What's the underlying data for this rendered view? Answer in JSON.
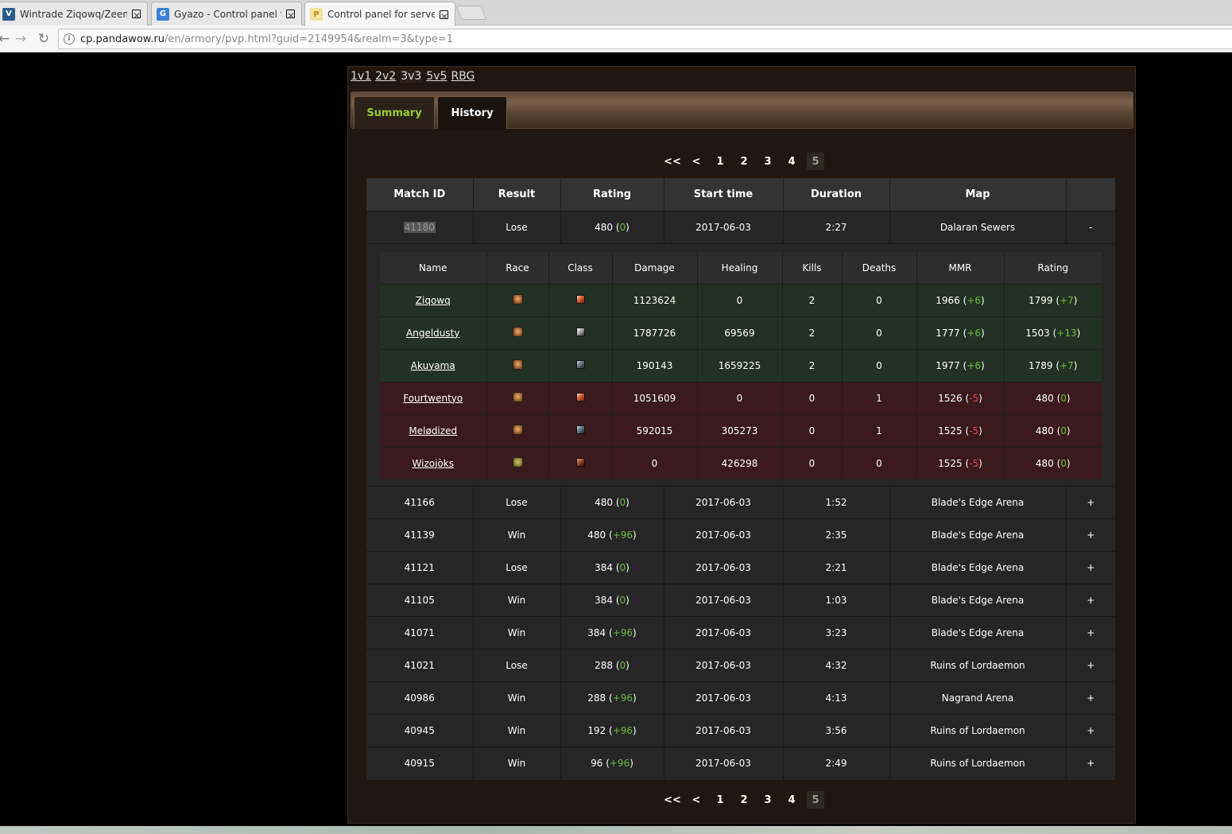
{
  "browser": {
    "tabs": [
      {
        "title": "Wintrade Ziqowq/Zeems",
        "fav": "V",
        "fav_bg": "#2a5d8f"
      },
      {
        "title": "Gyazo - Control panel fo",
        "fav": "G",
        "fav_bg": "#3b7fd6"
      },
      {
        "title": "Control panel for server",
        "fav": "P",
        "fav_bg": "#f3e3a0"
      }
    ],
    "close_glyph": "✕",
    "url_host": "cp.pandawow.ru",
    "url_path": "/en/armory/pvp.html?guid=2149954&realm=3&type=1"
  },
  "brackets": [
    "1v1",
    "2v2",
    "3v3",
    "5v5",
    "RBG"
  ],
  "current_bracket": "3v3",
  "tabs": {
    "summary": "Summary",
    "history": "History"
  },
  "pager": {
    "first": "<<",
    "prev": "<",
    "pages": [
      "1",
      "2",
      "3",
      "4"
    ],
    "current": "5"
  },
  "match_headers": [
    "Match ID",
    "Result",
    "Rating",
    "Start time",
    "Duration",
    "Map",
    ""
  ],
  "expanded_match": {
    "id": "41180",
    "result": "Lose",
    "rating": "480",
    "rating_change": "0",
    "start": "2017-06-03",
    "duration": "2:27",
    "map": "Dalaran Sewers",
    "toggle": "-"
  },
  "detail_headers": [
    "Name",
    "Race",
    "Class",
    "Damage",
    "Healing",
    "Kills",
    "Deaths",
    "MMR",
    "Rating"
  ],
  "players": [
    {
      "name": "Ziqowq",
      "race": "orc-icon",
      "class": "rogue-icon",
      "damage": "1123624",
      "healing": "0",
      "kills": "2",
      "deaths": "0",
      "mmr": "1966",
      "mmr_change": "+6",
      "rating": "1799",
      "rating_change": "+7",
      "team": "winner"
    },
    {
      "name": "Angeldusty",
      "race": "orc-icon",
      "class": "warrior-icon",
      "damage": "1787726",
      "healing": "69569",
      "kills": "2",
      "deaths": "0",
      "mmr": "1777",
      "mmr_change": "+6",
      "rating": "1503",
      "rating_change": "+13",
      "team": "winner"
    },
    {
      "name": "Akuyama",
      "race": "orc-icon",
      "class": "priest-icon",
      "damage": "190143",
      "healing": "1659225",
      "kills": "2",
      "deaths": "0",
      "mmr": "1977",
      "mmr_change": "+6",
      "rating": "1789",
      "rating_change": "+7",
      "team": "winner"
    },
    {
      "name": "Fourtwentyo",
      "race": "orc-icon",
      "class": "rogue-icon",
      "damage": "1051609",
      "healing": "0",
      "kills": "0",
      "deaths": "1",
      "mmr": "1526",
      "mmr_change": "-5",
      "rating": "480",
      "rating_change": "0",
      "team": "loser"
    },
    {
      "name": "Melødized",
      "race": "orc-icon",
      "class": "priest-icon",
      "damage": "592015",
      "healing": "305273",
      "kills": "0",
      "deaths": "1",
      "mmr": "1525",
      "mmr_change": "-5",
      "rating": "480",
      "rating_change": "0",
      "team": "loser"
    },
    {
      "name": "Wizojòks",
      "race": "goblin-icon",
      "class": "warlock-icon",
      "damage": "0",
      "healing": "426298",
      "kills": "0",
      "deaths": "0",
      "mmr": "1525",
      "mmr_change": "-5",
      "rating": "480",
      "rating_change": "0",
      "team": "loser"
    }
  ],
  "matches": [
    {
      "id": "41166",
      "result": "Lose",
      "rating": "480",
      "rating_change": "0",
      "start": "2017-06-03",
      "duration": "1:52",
      "map": "Blade's Edge Arena",
      "toggle": "+"
    },
    {
      "id": "41139",
      "result": "Win",
      "rating": "480",
      "rating_change": "+96",
      "start": "2017-06-03",
      "duration": "2:35",
      "map": "Blade's Edge Arena",
      "toggle": "+"
    },
    {
      "id": "41121",
      "result": "Lose",
      "rating": "384",
      "rating_change": "0",
      "start": "2017-06-03",
      "duration": "2:21",
      "map": "Blade's Edge Arena",
      "toggle": "+"
    },
    {
      "id": "41105",
      "result": "Win",
      "rating": "384",
      "rating_change": "0",
      "start": "2017-06-03",
      "duration": "1:03",
      "map": "Blade's Edge Arena",
      "toggle": "+"
    },
    {
      "id": "41071",
      "result": "Win",
      "rating": "384",
      "rating_change": "+96",
      "start": "2017-06-03",
      "duration": "3:23",
      "map": "Blade's Edge Arena",
      "toggle": "+"
    },
    {
      "id": "41021",
      "result": "Lose",
      "rating": "288",
      "rating_change": "0",
      "start": "2017-06-03",
      "duration": "4:32",
      "map": "Ruins of Lordaemon",
      "toggle": "+"
    },
    {
      "id": "40986",
      "result": "Win",
      "rating": "288",
      "rating_change": "+96",
      "start": "2017-06-03",
      "duration": "4:13",
      "map": "Nagrand Arena",
      "toggle": "+"
    },
    {
      "id": "40945",
      "result": "Win",
      "rating": "192",
      "rating_change": "+96",
      "start": "2017-06-03",
      "duration": "3:56",
      "map": "Ruins of Lordaemon",
      "toggle": "+"
    },
    {
      "id": "40915",
      "result": "Win",
      "rating": "96",
      "rating_change": "+96",
      "start": "2017-06-03",
      "duration": "2:49",
      "map": "Ruins of Lordaemon",
      "toggle": "+"
    }
  ],
  "colors": {
    "accent_green": "#9acd32",
    "gain": "#6abf40",
    "loss": "#e04848",
    "winner_row": "#223222",
    "loser_row": "#3a1a1c"
  }
}
